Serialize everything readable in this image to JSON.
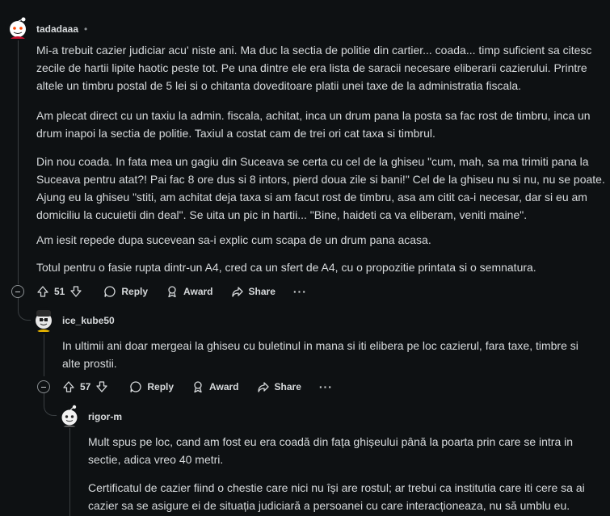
{
  "comments": [
    {
      "username": "tadadaaa",
      "dot": "•",
      "paragraphs": [
        "Mi-a trebuit cazier judiciar acu' niste ani. Ma duc la sectia de politie din cartier... coada... timp suficient sa citesc zecile de hartii lipite haotic peste tot. Pe una dintre ele era lista de saracii necesare eliberarii cazierului. Printre altele un timbru postal de 5 lei si o chitanta doveditoare platii unei taxe de la administratia fiscala.",
        "Am plecat direct cu un taxiu la admin. fiscala, achitat, inca un drum pana la posta sa fac rost de timbru, inca un drum inapoi la sectia de politie. Taxiul a costat cam de trei ori cat taxa si timbrul.",
        "Din nou coada. In fata mea un gagiu din Suceava se certa cu cel de la ghiseu \"cum, mah, sa ma trimiti pana la Suceava pentru atat?! Pai fac 8 ore dus si 8 intors, pierd doua zile si bani!\" Cel de la ghiseu nu si nu, nu se poate. Ajung eu la ghiseu \"stiti, am achitat deja taxa si am facut rost de timbru, asa am citit ca-i necesar, dar si eu am domiciliu la cucuietii din deal\". Se uita un pic in hartii... \"Bine, haideti ca va eliberam, veniti maine\".",
        "Am iesit repede dupa sucevean sa-i explic cum scapa de un drum pana acasa.",
        "Totul pentru o fasie rupta dintr-un A4, cred ca un sfert de A4, cu o propozitie printata si o semnatura."
      ],
      "votes": "51",
      "reply_label": "Reply",
      "award_label": "Award",
      "share_label": "Share",
      "more_label": "···"
    },
    {
      "username": "ice_kube50",
      "paragraphs": [
        "In ultimii ani doar mergeai la ghiseu cu buletinul in mana si iti elibera pe loc cazierul, fara taxe, timbre si alte prostii."
      ],
      "votes": "57",
      "reply_label": "Reply",
      "award_label": "Award",
      "share_label": "Share",
      "more_label": "···"
    },
    {
      "username": "rigor-m",
      "paragraphs": [
        "Mult spus pe loc, cand am fost eu era coadă din fața ghișeului până la poarta prin care se intra in sectie, adica vreo 40 metri.",
        "Certificatul de cazier fiind o chestie care nici nu își are rostul; ar trebui ca institutia care iti cere sa ai cazier sa se asigure ei de situația judiciară a persoanei cu care interacționeaza, nu să umblu eu."
      ]
    }
  ],
  "colors": {
    "background": "#0e1113",
    "text": "#d7dadc",
    "muted": "#8b9093",
    "thread_line": "#3a3f42"
  }
}
